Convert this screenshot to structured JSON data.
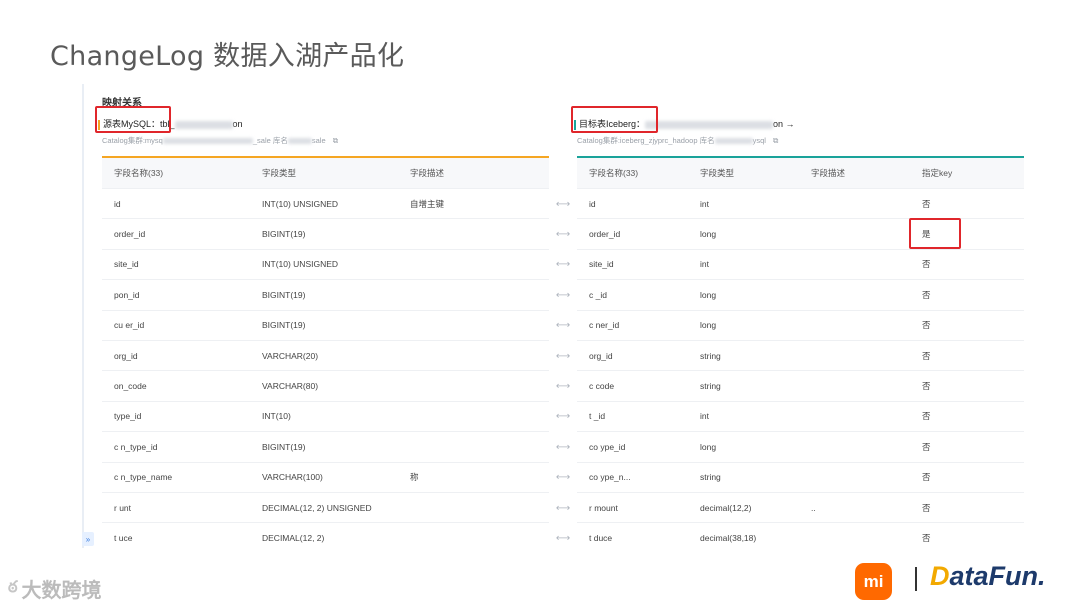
{
  "slide": {
    "title": "ChangeLog 数据入湖产品化"
  },
  "mapping": {
    "section_title": "映射关系",
    "source": {
      "label": "源表MySQL：",
      "table_prefix": "tbl_",
      "table_suffix": "on",
      "catalog_prefix": "Catalog集群:mysq",
      "catalog_mid": "_sale  库名",
      "catalog_suffix": "sale",
      "columns": [
        "字段名称(33)",
        "字段类型",
        "字段描述"
      ],
      "rows": [
        [
          "id",
          "INT(10) UNSIGNED",
          "自增主键"
        ],
        [
          "order_id",
          "BIGINT(19)",
          ""
        ],
        [
          "site_id",
          "INT(10) UNSIGNED",
          ""
        ],
        [
          "pon_id",
          "BIGINT(19)",
          ""
        ],
        [
          "cu  er_id",
          "BIGINT(19)",
          ""
        ],
        [
          "org_id",
          "VARCHAR(20)",
          ""
        ],
        [
          "on_code",
          "VARCHAR(80)",
          ""
        ],
        [
          "type_id",
          "INT(10)",
          ""
        ],
        [
          "c  n_type_id",
          "BIGINT(19)",
          ""
        ],
        [
          "c  n_type_name",
          "VARCHAR(100)",
          "称"
        ],
        [
          "r  unt",
          "DECIMAL(12, 2) UNSIGNED",
          ""
        ],
        [
          "t  uce",
          "DECIMAL(12, 2)",
          ""
        ]
      ]
    },
    "target": {
      "label": "目标表Iceberg：",
      "table_suffix": "on →",
      "catalog_prefix": "Catalog集群:iceberg_zjyprc_hadoop  库名",
      "catalog_suffix": "ysql",
      "columns": [
        "字段名称(33)",
        "字段类型",
        "字段描述",
        "指定key"
      ],
      "rows": [
        [
          "id",
          "int",
          "",
          "否"
        ],
        [
          "order_id",
          "long",
          "",
          "是"
        ],
        [
          "site_id",
          "int",
          "",
          "否"
        ],
        [
          "c  _id",
          "long",
          "",
          "否"
        ],
        [
          "c  ner_id",
          "long",
          "",
          "否"
        ],
        [
          "org_id",
          "string",
          "",
          "否"
        ],
        [
          "c  code",
          "string",
          "",
          "否"
        ],
        [
          "t  _id",
          "int",
          "",
          "否"
        ],
        [
          "co  ype_id",
          "long",
          "",
          "否"
        ],
        [
          "co  ype_n...",
          "string",
          "",
          "否"
        ],
        [
          "r  mount",
          "decimal(12,2)",
          "..",
          "否"
        ],
        [
          "t  duce",
          "decimal(38,18)",
          "",
          "否"
        ]
      ]
    },
    "arrow_glyph": "⟷"
  },
  "footer": {
    "left_brand": "大数跨境",
    "mi_text": "mi",
    "separator": "|",
    "right_brand_prefix": "D",
    "right_brand_rest": "ataFun."
  },
  "colors": {
    "source_accent": "#f5a623",
    "target_accent": "#1aa39a",
    "highlight": "#e0262b"
  }
}
